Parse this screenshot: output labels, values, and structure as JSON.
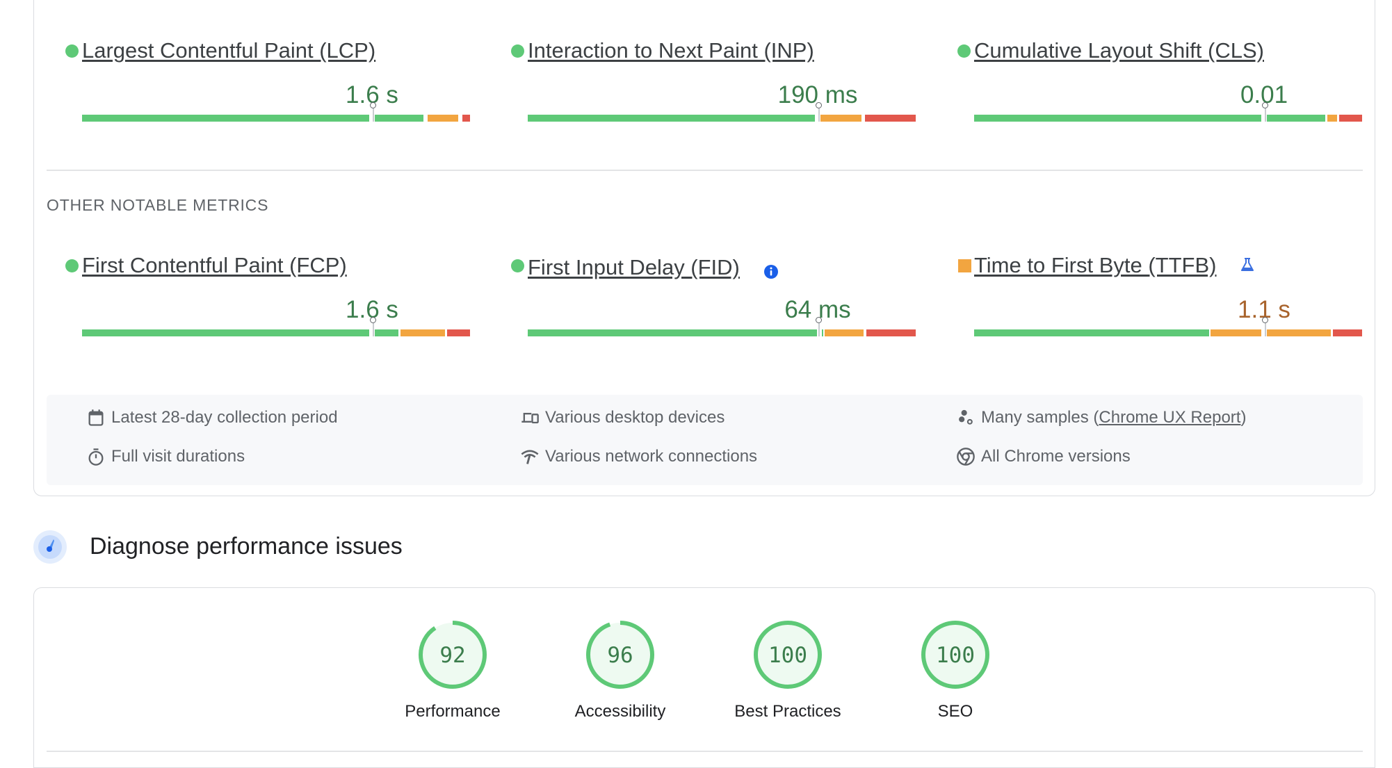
{
  "core_metrics": [
    {
      "name": "Largest Contentful Paint (LCP)",
      "value": "1.6 s",
      "status": "good",
      "marker_fraction": 0.75,
      "segments": [
        {
          "c": "g",
          "from": 0,
          "to": 0.74
        },
        {
          "c": "g",
          "from": 0.755,
          "to": 0.88
        },
        {
          "c": "o",
          "from": 0.89,
          "to": 0.97
        },
        {
          "c": "r",
          "from": 0.98,
          "to": 1.0
        }
      ]
    },
    {
      "name": "Interaction to Next Paint (INP)",
      "value": "190 ms",
      "status": "good",
      "marker_fraction": 0.75,
      "segments": [
        {
          "c": "g",
          "from": 0,
          "to": 0.74
        },
        {
          "c": "o",
          "from": 0.755,
          "to": 0.86
        },
        {
          "c": "r",
          "from": 0.87,
          "to": 1.0
        }
      ]
    },
    {
      "name": "Cumulative Layout Shift (CLS)",
      "value": "0.01",
      "status": "good",
      "marker_fraction": 0.75,
      "segments": [
        {
          "c": "g",
          "from": 0,
          "to": 0.74
        },
        {
          "c": "g",
          "from": 0.755,
          "to": 0.905
        },
        {
          "c": "o",
          "from": 0.91,
          "to": 0.935
        },
        {
          "c": "r",
          "from": 0.94,
          "to": 1.0
        }
      ]
    }
  ],
  "other_section_label": "OTHER NOTABLE METRICS",
  "other_metrics": [
    {
      "name": "First Contentful Paint (FCP)",
      "value": "1.6 s",
      "status": "good",
      "marker_fraction": 0.75,
      "segments": [
        {
          "c": "g",
          "from": 0,
          "to": 0.74
        },
        {
          "c": "g",
          "from": 0.755,
          "to": 0.815
        },
        {
          "c": "o",
          "from": 0.82,
          "to": 0.935
        },
        {
          "c": "r",
          "from": 0.94,
          "to": 1.0
        }
      ],
      "badge": null
    },
    {
      "name": "First Input Delay (FID)",
      "value": "64 ms",
      "status": "good",
      "marker_fraction": 0.75,
      "segments": [
        {
          "c": "g",
          "from": 0,
          "to": 0.745
        },
        {
          "c": "g",
          "from": 0.758,
          "to": 0.762
        },
        {
          "c": "o",
          "from": 0.765,
          "to": 0.865
        },
        {
          "c": "r",
          "from": 0.873,
          "to": 1.0
        }
      ],
      "badge": "info-icon"
    },
    {
      "name": "Time to First Byte (TTFB)",
      "value": "1.1 s",
      "status": "needs-improvement",
      "marker_fraction": 0.75,
      "segments": [
        {
          "c": "g",
          "from": 0,
          "to": 0.605
        },
        {
          "c": "o",
          "from": 0.61,
          "to": 0.74
        },
        {
          "c": "o",
          "from": 0.755,
          "to": 0.92
        },
        {
          "c": "r",
          "from": 0.925,
          "to": 1.0
        }
      ],
      "badge": "experimental-flask-icon"
    }
  ],
  "info": {
    "collection_period": "Latest 28-day collection period",
    "devices": "Various desktop devices",
    "samples_prefix": "Many samples (",
    "samples_link": "Chrome UX Report",
    "samples_suffix": ")",
    "visit_durations": "Full visit durations",
    "network": "Various network connections",
    "chrome_versions": "All Chrome versions"
  },
  "diagnose": {
    "title": "Diagnose performance issues"
  },
  "scores": [
    {
      "label": "Performance",
      "score": 92
    },
    {
      "label": "Accessibility",
      "score": 96
    },
    {
      "label": "Best Practices",
      "score": 100
    },
    {
      "label": "SEO",
      "score": 100
    }
  ],
  "colors": {
    "good": "#5ec977",
    "average": "#f2a540",
    "poor": "#e2574c",
    "good_text": "#3b7d4c",
    "avg_text": "#a8632c",
    "link_blue": "#1a73e8"
  }
}
